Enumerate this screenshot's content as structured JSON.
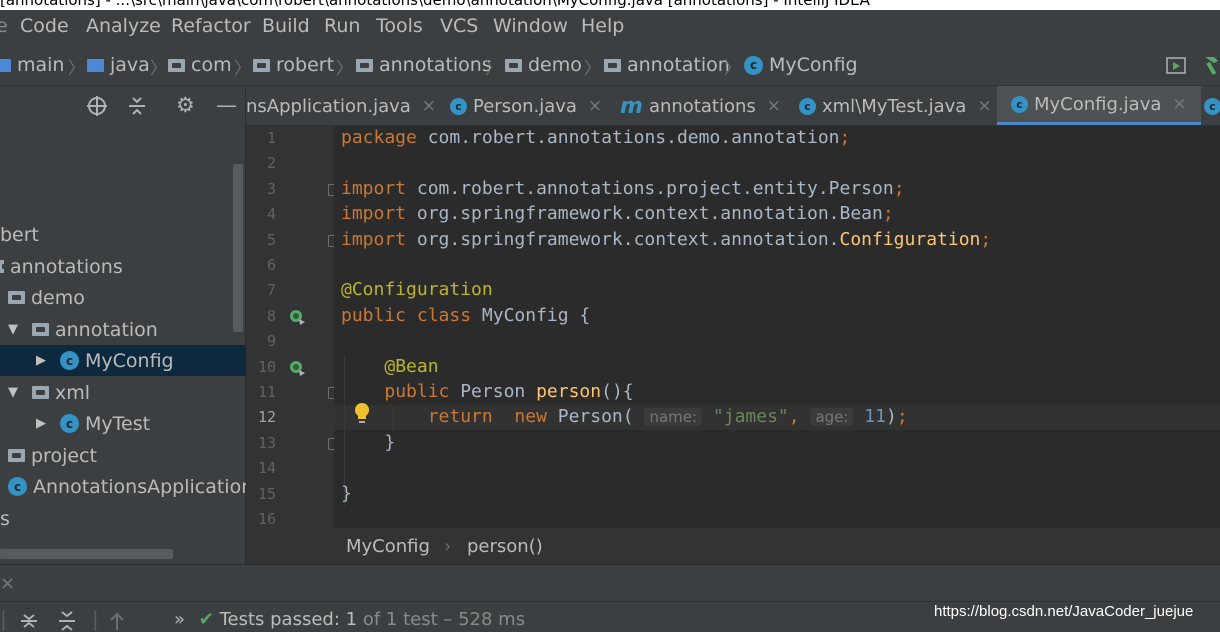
{
  "window": {
    "title": "[annotations] - ...\\src\\main\\java\\com\\robert\\annotations\\demo\\annotation\\MyConfig.java [annotations] - IntelliJ IDEA"
  },
  "menu": [
    "Code",
    "Analyze",
    "Refactor",
    "Build",
    "Run",
    "Tools",
    "VCS",
    "Window",
    "Help"
  ],
  "breadcrumbs": [
    "main",
    "java",
    "com",
    "robert",
    "annotations",
    "demo",
    "annotation",
    "MyConfig"
  ],
  "project_tree": [
    {
      "label": "bert"
    },
    {
      "label": "annotations"
    },
    {
      "label": "demo"
    },
    {
      "label": "annotation"
    },
    {
      "label": "MyConfig",
      "selected": true
    },
    {
      "label": "xml"
    },
    {
      "label": "MyTest"
    },
    {
      "label": "project"
    },
    {
      "label": "AnnotationsApplication"
    },
    {
      "label": "s"
    }
  ],
  "tabs": [
    {
      "label": "nsApplication.java"
    },
    {
      "label": "Person.java"
    },
    {
      "label": "annotations"
    },
    {
      "label": "xml\\MyTest.java"
    },
    {
      "label": "MyConfig.java",
      "active": true
    }
  ],
  "editor": {
    "line_numbers": [
      "1",
      "2",
      "3",
      "4",
      "5",
      "6",
      "7",
      "8",
      "9",
      "10",
      "11",
      "12",
      "13",
      "14",
      "15",
      "16"
    ],
    "current_line": "12",
    "lines": [
      {
        "n": "1",
        "tokens": [
          [
            "kw",
            "package "
          ],
          [
            "plain",
            "com.robert.annotations.demo.annotation"
          ],
          [
            "kw",
            ";"
          ]
        ]
      },
      {
        "n": "2",
        "tokens": []
      },
      {
        "n": "3",
        "tokens": [
          [
            "kw",
            "import "
          ],
          [
            "plain",
            "com.robert.annotations.project.entity.Person"
          ],
          [
            "kw",
            ";"
          ]
        ]
      },
      {
        "n": "4",
        "tokens": [
          [
            "kw",
            "import "
          ],
          [
            "plain",
            "org.springframework.context.annotation.Bean"
          ],
          [
            "kw",
            ";"
          ]
        ]
      },
      {
        "n": "5",
        "tokens": [
          [
            "kw",
            "import "
          ],
          [
            "plain",
            "org.springframework.context.annotation."
          ],
          [
            "fn",
            "Configuration"
          ],
          [
            "kw",
            ";"
          ]
        ]
      },
      {
        "n": "6",
        "tokens": []
      },
      {
        "n": "7",
        "tokens": [
          [
            "ann",
            "@Configuration"
          ]
        ]
      },
      {
        "n": "8",
        "tokens": [
          [
            "kw",
            "public class "
          ],
          [
            "plain",
            "MyConfig {"
          ]
        ]
      },
      {
        "n": "9",
        "tokens": []
      },
      {
        "n": "10",
        "tokens": [
          [
            "plain",
            "    "
          ],
          [
            "ann",
            "@Bean"
          ]
        ]
      },
      {
        "n": "11",
        "tokens": [
          [
            "plain",
            "    "
          ],
          [
            "kw",
            "public "
          ],
          [
            "plain",
            "Person "
          ],
          [
            "fn",
            "person"
          ],
          [
            "plain",
            "(){"
          ]
        ]
      },
      {
        "n": "12",
        "tokens": [
          [
            "plain",
            "        "
          ],
          [
            "kw",
            "return  new "
          ],
          [
            "plain",
            "Person( "
          ],
          [
            "hint",
            "name:"
          ],
          [
            "plain",
            " "
          ],
          [
            "str",
            "\"james\""
          ],
          [
            "kw",
            ", "
          ],
          [
            "hint",
            "age:"
          ],
          [
            "plain",
            " "
          ],
          [
            "num",
            "11"
          ],
          [
            "plain",
            ")"
          ],
          [
            "kw",
            ";"
          ]
        ]
      },
      {
        "n": "13",
        "tokens": [
          [
            "plain",
            "    }"
          ]
        ]
      },
      {
        "n": "14",
        "tokens": []
      },
      {
        "n": "15",
        "tokens": [
          [
            "plain",
            "}"
          ]
        ]
      },
      {
        "n": "16",
        "tokens": []
      }
    ]
  },
  "editor_breadcrumb": [
    "MyConfig",
    "person()"
  ],
  "bottom": {
    "close": "×",
    "status_prefix": "Tests passed:",
    "passed": "1",
    "of_text": "of 1 test",
    "duration": "– 528 ms",
    "more": "»"
  },
  "watermark": "https://blog.csdn.net/JavaCoder_juejue",
  "colors": {
    "accent": "#4a88c7",
    "selection": "#0d293e",
    "keyword": "#cc7832",
    "annotation": "#bbb529",
    "string": "#6a8759",
    "number": "#6897bb",
    "method": "#ffc66d",
    "pass": "#59a869"
  },
  "icons": [
    "folder-icon",
    "class-icon",
    "locate-icon",
    "collapse-icon",
    "gear-icon",
    "minimize-icon",
    "bean-icon",
    "bulb-icon",
    "check-icon",
    "expand-all-icon",
    "collapse-all-icon",
    "up-icon",
    "run-icon",
    "build-hammer-icon"
  ]
}
